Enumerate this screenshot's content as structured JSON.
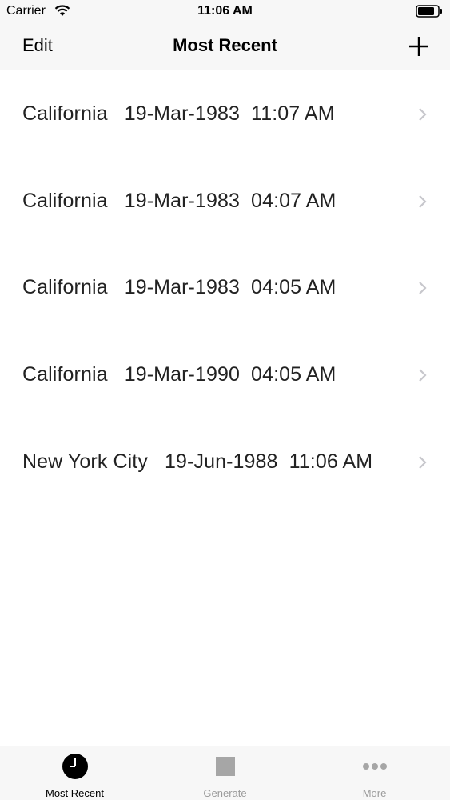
{
  "status_bar": {
    "carrier": "Carrier",
    "time": "11:06 AM",
    "icons": [
      "wifi-icon",
      "battery-icon"
    ]
  },
  "nav": {
    "left_label": "Edit",
    "title": "Most Recent",
    "right_icon": "plus-icon"
  },
  "rows": [
    {
      "label": "California   19-Mar-1983  11:07 AM"
    },
    {
      "label": "California   19-Mar-1983  04:07 AM"
    },
    {
      "label": "California   19-Mar-1983  04:05 AM"
    },
    {
      "label": "California   19-Mar-1990  04:05 AM"
    },
    {
      "label": "New York City   19-Jun-1988  11:06 AM"
    }
  ],
  "tabs": [
    {
      "label": "Most Recent",
      "icon": "clock-icon",
      "active": true
    },
    {
      "label": "Generate",
      "icon": "square-icon",
      "active": false
    },
    {
      "label": "More",
      "icon": "more-dots-icon",
      "active": false
    }
  ],
  "colors": {
    "bar_background": "#f7f7f7",
    "active_tab": "#000000",
    "inactive_tab": "#9b9b9b",
    "chevron": "#c7c7cc"
  }
}
